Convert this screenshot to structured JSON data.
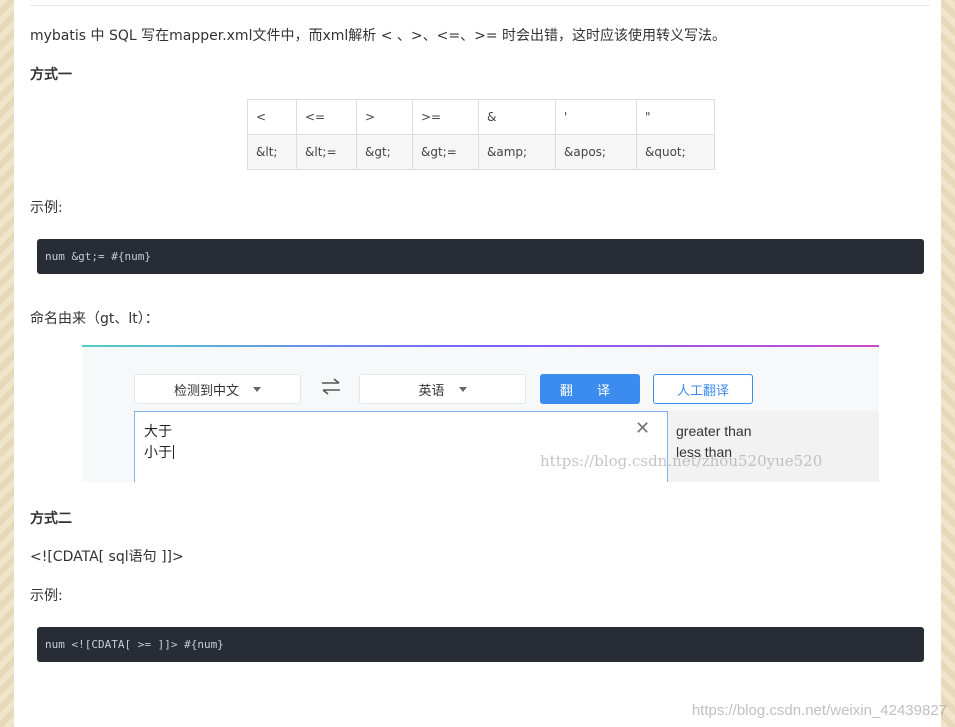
{
  "intro": "mybatis 中 SQL 写在mapper.xml文件中，而xml解析 < 、>、<=、>= 时会出错，这时应该使用转义写法。",
  "method1_heading": "方式一",
  "escape_table": {
    "symbols": [
      "<",
      "<=",
      ">",
      ">=",
      "&",
      "'",
      "\""
    ],
    "escapes": [
      "&lt;",
      "&lt;=",
      "&gt;",
      "&gt;=",
      "&amp;",
      "&apos;",
      "&quot;"
    ]
  },
  "example_label_1": "示例:",
  "code_1": "num &gt;= #{num}",
  "naming_origin": "命名由来（gt、lt）：",
  "translator": {
    "source_lang": "检测到中文",
    "target_lang": "英语",
    "translate_button": "翻  译",
    "human_button": "人工翻译",
    "source_lines": [
      "大于",
      "小于"
    ],
    "clear_icon": "close-icon",
    "result_lines": [
      "greater than",
      "less than"
    ],
    "watermark": "https://blog.csdn.net/zhou520yue520"
  },
  "method2_heading": "方式二",
  "cdata_text": "<![CDATA[  sql语句  ]]>",
  "example_label_2": "示例:",
  "code_2": "num <![CDATA[ >= ]]> #{num}",
  "page_watermark": "https://blog.csdn.net/weixin_42439827"
}
